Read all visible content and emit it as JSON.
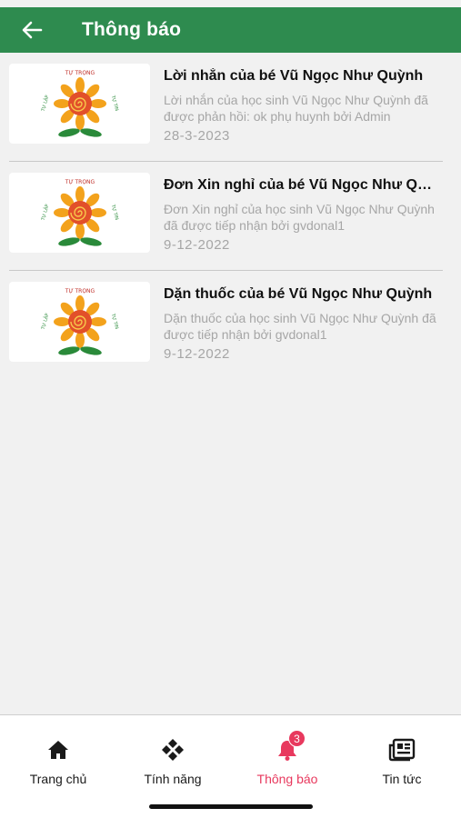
{
  "header": {
    "title": "Thông báo"
  },
  "notifications": [
    {
      "title": "Lời nhắn của bé Vũ Ngọc Như Quỳnh",
      "description": "Lời nhắn của học sinh Vũ Ngọc Như Quỳnh đã được phản hồi: ok phụ huynh bởi Admin",
      "date": "28-3-2023"
    },
    {
      "title": "Đơn Xin nghỉ của bé Vũ Ngọc Như Quỳnh",
      "description": "Đơn Xin nghỉ của học sinh Vũ Ngọc Như Quỳnh đã được tiếp nhận bởi gvdonal1",
      "date": "9-12-2022"
    },
    {
      "title": "Dặn thuốc của bé Vũ Ngọc Như Quỳnh",
      "description": "Dặn thuốc của học sinh Vũ Ngọc Như Quỳnh đã được tiếp nhận bởi gvdonal1",
      "date": "9-12-2022"
    }
  ],
  "logo": {
    "top_text": "TỰ TRỌNG",
    "left_text": "TỰ LẬP",
    "right_text": "TỰ TIN"
  },
  "bottom_nav": {
    "items": [
      {
        "label": "Trang chủ",
        "icon": "home-icon"
      },
      {
        "label": "Tính năng",
        "icon": "features-icon"
      },
      {
        "label": "Thông báo",
        "icon": "bell-icon",
        "badge": "3",
        "active": true
      },
      {
        "label": "Tin tức",
        "icon": "news-icon"
      }
    ]
  },
  "colors": {
    "primary": "#2e8b4f",
    "active": "#e8395e",
    "background": "#f1f1f1"
  }
}
